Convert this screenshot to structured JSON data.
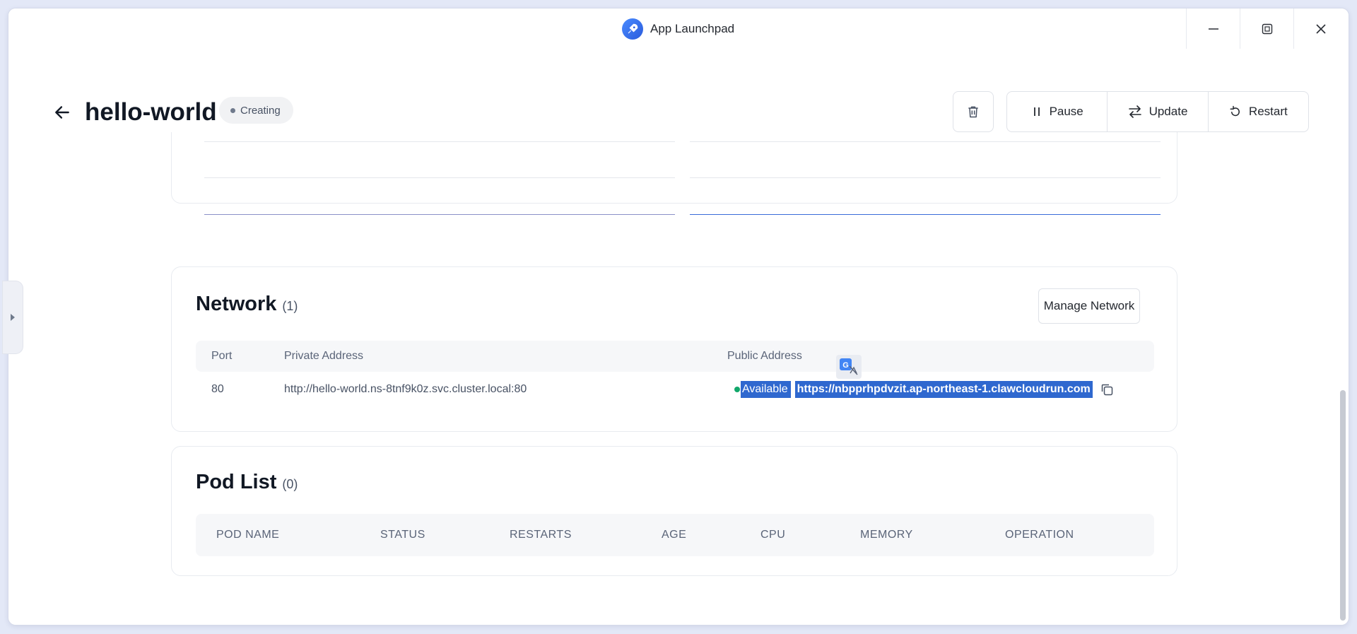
{
  "window": {
    "title": "App Launchpad",
    "controls": [
      "minimize-icon",
      "maximize-icon",
      "close-icon"
    ]
  },
  "header": {
    "app_name": "hello-world",
    "status": "Creating",
    "actions": {
      "pause": "Pause",
      "update": "Update",
      "restart": "Restart"
    }
  },
  "network": {
    "title": "Network",
    "count": "(1)",
    "manage_label": "Manage Network",
    "columns": {
      "port": "Port",
      "private": "Private Address",
      "public": "Public Address"
    },
    "rows": [
      {
        "port": "80",
        "private_address": "http://hello-world.ns-8tnf9k0z.svc.cluster.local:80",
        "status": "Available",
        "public_address": "https://nbpprhpdvzit.ap-northeast-1.clawcloudrun.com"
      }
    ]
  },
  "pods": {
    "title": "Pod List",
    "count": "(0)",
    "columns": {
      "name": "POD NAME",
      "status": "STATUS",
      "restarts": "RESTARTS",
      "age": "AGE",
      "cpu": "CPU",
      "memory": "MEMORY",
      "operation": "OPERATION"
    }
  },
  "colors": {
    "accent": "#2f68cf",
    "available": "#12a76b",
    "status_dot": "#6f7a8c"
  }
}
